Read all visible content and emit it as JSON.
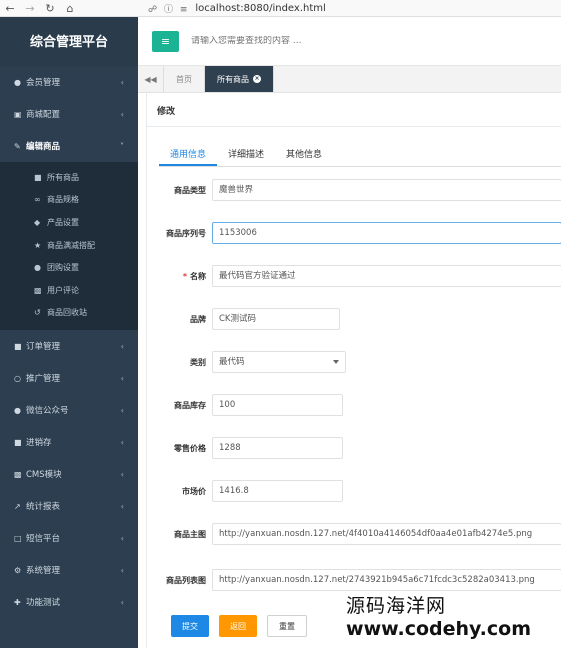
{
  "browser": {
    "url": "localhost:8080/index.html"
  },
  "sidebar": {
    "title": "综合管理平台",
    "menu_before": [
      {
        "label": "会员管理",
        "icon": "user-circle-icon"
      },
      {
        "label": "商城配置",
        "icon": "cart-icon"
      }
    ],
    "open_menu": {
      "label": "编辑商品",
      "icon": "edit-icon"
    },
    "submenu": [
      {
        "label": "所有商品",
        "icon": "shop-icon"
      },
      {
        "label": "商品规格",
        "icon": "link-icon"
      },
      {
        "label": "产品设置",
        "icon": "tag-icon"
      },
      {
        "label": "商品满减搭配",
        "icon": "trophy-icon"
      },
      {
        "label": "团购设置",
        "icon": "group-icon"
      },
      {
        "label": "用户评论",
        "icon": "comment-icon"
      },
      {
        "label": "商品回收站",
        "icon": "recycle-icon"
      }
    ],
    "menu_after": [
      {
        "label": "订单管理",
        "icon": "cube-icon"
      },
      {
        "label": "推广管理",
        "icon": "hand-icon"
      },
      {
        "label": "微信公众号",
        "icon": "wechat-icon"
      },
      {
        "label": "进销存",
        "icon": "truck-icon"
      },
      {
        "label": "CMS模块",
        "icon": "keyboard-icon"
      },
      {
        "label": "统计报表",
        "icon": "chart-icon"
      },
      {
        "label": "短信平台",
        "icon": "desktop-icon"
      },
      {
        "label": "系统管理",
        "icon": "gear-icon"
      },
      {
        "label": "功能测试",
        "icon": "gamepad-icon"
      }
    ]
  },
  "header": {
    "search_placeholder": "请输入您需要查找的内容 ..."
  },
  "tabs": {
    "home": "首页",
    "active": "所有商品"
  },
  "panel": {
    "title": "修改",
    "form_tabs": [
      "通用信息",
      "详细描述",
      "其他信息"
    ]
  },
  "form": {
    "type": {
      "label": "商品类型",
      "value": "魔兽世界"
    },
    "serial": {
      "label": "商品序列号",
      "value": "1153006"
    },
    "name": {
      "label": "名称",
      "value": "最代码官方验证通过"
    },
    "brand": {
      "label": "品牌",
      "value": "CK测试码"
    },
    "category": {
      "label": "类别",
      "value": "最代码"
    },
    "stock": {
      "label": "商品库存",
      "value": "100"
    },
    "retail": {
      "label": "零售价格",
      "value": "1288"
    },
    "market": {
      "label": "市场价",
      "value": "1416.8"
    },
    "main_image": {
      "label": "商品主图",
      "value": "http://yanxuan.nosdn.127.net/4f4010a4146054df0aa4e01afb4274e5.png"
    },
    "list_image": {
      "label": "商品列表图",
      "value": "http://yanxuan.nosdn.127.net/2743921b945a6c71fcdc3c5282a03413.png"
    }
  },
  "buttons": {
    "submit": "提交",
    "back": "返回",
    "reset": "重置"
  },
  "watermark": {
    "line1": "源码海洋网",
    "line2": "www.codehy.com"
  }
}
